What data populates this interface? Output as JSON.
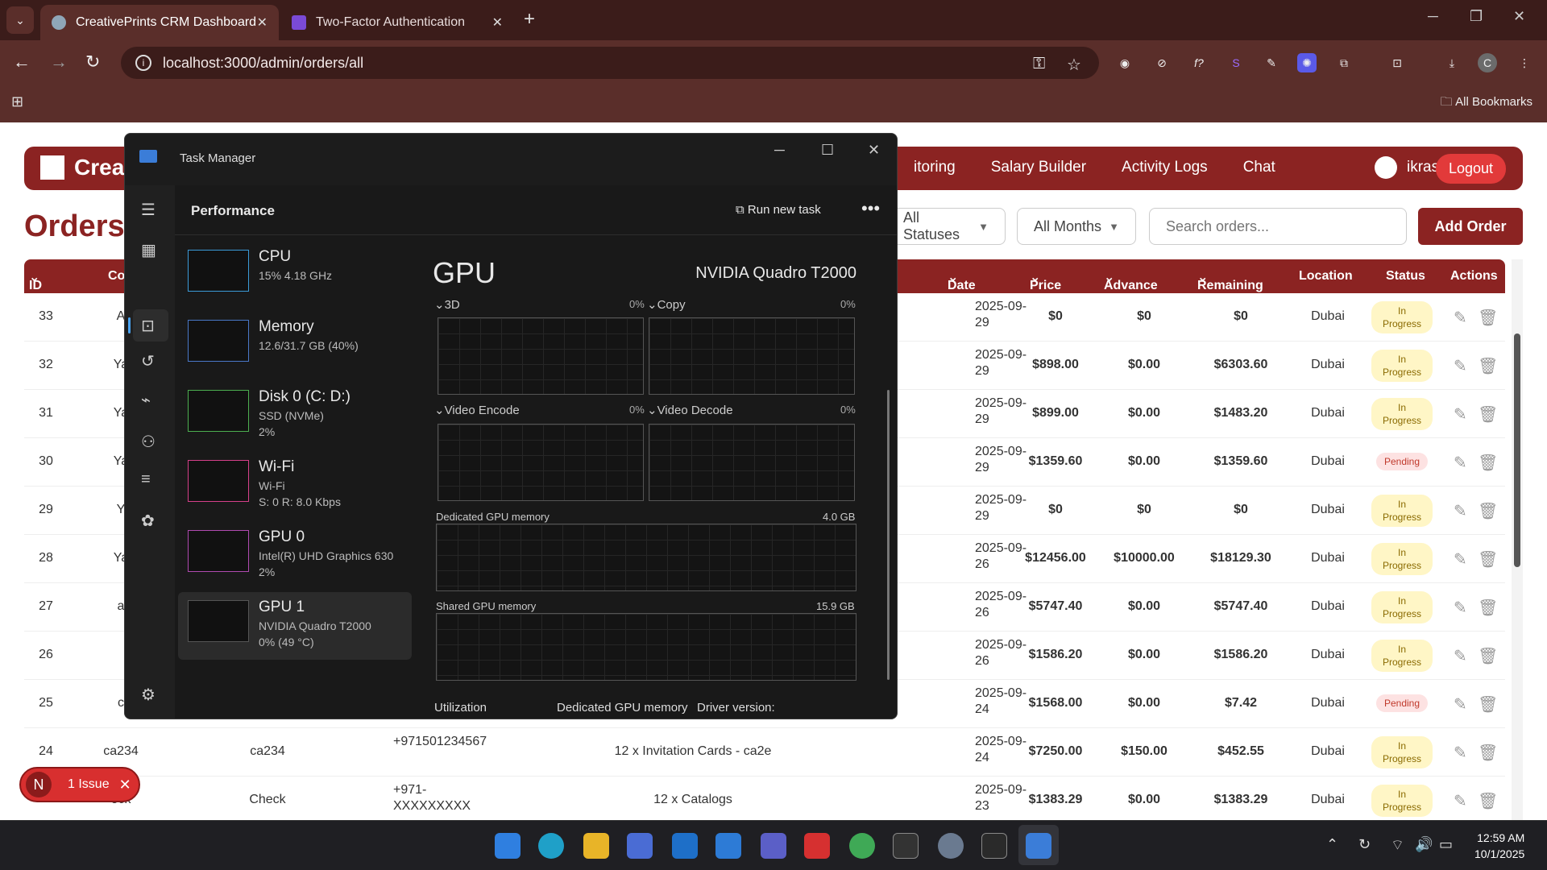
{
  "browser": {
    "tabs": [
      {
        "title": "CreativePrints CRM Dashboard",
        "close": "✕"
      },
      {
        "title": "Two-Factor Authentication",
        "close": "✕"
      }
    ],
    "new_tab": "+",
    "url": "localhost:3000/admin/orders/all",
    "bookmarks_label": "All Bookmarks",
    "profile_initial": "C",
    "accent": "#5a2e2a"
  },
  "crm": {
    "brand": "Creat",
    "nav": [
      "itoring",
      "Salary Builder",
      "Activity Logs",
      "Chat"
    ],
    "user": "ikrash",
    "logout": "Logout",
    "page_title": "Orders",
    "filter_status": "All Statuses",
    "filter_months": "All Months",
    "search_placeholder": "Search orders...",
    "add_order": "Add Order",
    "headers": {
      "id": "ID",
      "co": "Co",
      "date": "Date",
      "price": "Price",
      "advance": "Advance",
      "remaining": "Remaining",
      "location": "Location",
      "status": "Status",
      "actions": "Actions"
    },
    "brand_color": "#8b2322",
    "issue": {
      "letter": "N",
      "label": "1 Issue",
      "close": "✕"
    }
  },
  "rows": [
    {
      "id": "33",
      "c1": "A",
      "date1": "2025-09-",
      "date2": "29",
      "price": "$0",
      "advance": "$0",
      "remaining": "$0",
      "location": "Dubai",
      "status": "In Progress"
    },
    {
      "id": "32",
      "c1": "Ya",
      "date1": "2025-09-",
      "date2": "29",
      "price": "$898.00",
      "advance": "$0.00",
      "remaining": "$6303.60",
      "location": "Dubai",
      "status": "In Progress"
    },
    {
      "id": "31",
      "c1": "Ya",
      "date1": "2025-09-",
      "date2": "29",
      "price": "$899.00",
      "advance": "$0.00",
      "remaining": "$1483.20",
      "location": "Dubai",
      "status": "In Progress"
    },
    {
      "id": "30",
      "c1": "Ya",
      "date1": "2025-09-",
      "date2": "29",
      "price": "$1359.60",
      "advance": "$0.00",
      "remaining": "$1359.60",
      "location": "Dubai",
      "status": "Pending"
    },
    {
      "id": "29",
      "c1": "Y",
      "date1": "2025-09-",
      "date2": "29",
      "price": "$0",
      "advance": "$0",
      "remaining": "$0",
      "location": "Dubai",
      "status": "In Progress"
    },
    {
      "id": "28",
      "c1": "Ya",
      "date1": "2025-09-",
      "date2": "26",
      "price": "$12456.00",
      "advance": "$10000.00",
      "remaining": "$18129.30",
      "location": "Dubai",
      "status": "In Progress"
    },
    {
      "id": "27",
      "c1": "a",
      "date1": "2025-09-",
      "date2": "26",
      "price": "$5747.40",
      "advance": "$0.00",
      "remaining": "$5747.40",
      "location": "Dubai",
      "status": "In Progress"
    },
    {
      "id": "26",
      "c1": "",
      "date1": "2025-09-",
      "date2": "26",
      "price": "$1586.20",
      "advance": "$0.00",
      "remaining": "$1586.20",
      "location": "Dubai",
      "status": "In Progress"
    },
    {
      "id": "25",
      "c1": "c",
      "date1": "2025-09-",
      "date2": "24",
      "price": "$1568.00",
      "advance": "$0.00",
      "remaining": "$7.42",
      "location": "Dubai",
      "status": "Pending"
    },
    {
      "id": "24",
      "c1": "ca234",
      "c2": "ca234",
      "phone1": "+971501234567",
      "phone2": "",
      "item": "12 x Invitation Cards - ca2e",
      "date1": "2025-09-",
      "date2": "24",
      "price": "$7250.00",
      "advance": "$150.00",
      "remaining": "$452.55",
      "location": "Dubai",
      "status": "In Progress"
    },
    {
      "id": "",
      "c1": "eck",
      "c2": "Check",
      "phone1": "+971-",
      "phone2": "XXXXXXXXX",
      "item": "12 x Catalogs",
      "date1": "2025-09-",
      "date2": "23",
      "price": "$1383.29",
      "advance": "$0.00",
      "remaining": "$1383.29",
      "location": "Dubai",
      "status": "In Progress"
    }
  ],
  "taskmgr": {
    "title": "Task Manager",
    "section": "Performance",
    "run_new_task": "Run new task",
    "more": "•••",
    "devices": [
      {
        "name": "CPU",
        "sub1": "15%  4.18 GHz",
        "sub2": ""
      },
      {
        "name": "Memory",
        "sub1": "12.6/31.7 GB (40%)",
        "sub2": ""
      },
      {
        "name": "Disk 0 (C: D:)",
        "sub1": "SSD (NVMe)",
        "sub2": "2%"
      },
      {
        "name": "Wi-Fi",
        "sub1": "Wi-Fi",
        "sub2": "S: 0  R: 8.0 Kbps"
      },
      {
        "name": "GPU 0",
        "sub1": "Intel(R) UHD Graphics 630",
        "sub2": "2%"
      },
      {
        "name": "GPU 1",
        "sub1": "NVIDIA Quadro T2000",
        "sub2": "0%  (49 °C)"
      }
    ],
    "gpu_title": "GPU",
    "gpu_model": "NVIDIA Quadro T2000",
    "engines": [
      {
        "name": "3D",
        "pct": "0%"
      },
      {
        "name": "Copy",
        "pct": "0%"
      },
      {
        "name": "Video Encode",
        "pct": "0%"
      },
      {
        "name": "Video Decode",
        "pct": "0%"
      }
    ],
    "dedicated_label": "Dedicated GPU memory",
    "dedicated_value": "4.0 GB",
    "shared_label": "Shared GPU memory",
    "shared_value": "15.9 GB",
    "footer": [
      "Utilization",
      "Dedicated GPU memory",
      "Driver version:"
    ]
  },
  "taskbar": {
    "time": "12:59 AM",
    "date": "10/1/2025"
  }
}
